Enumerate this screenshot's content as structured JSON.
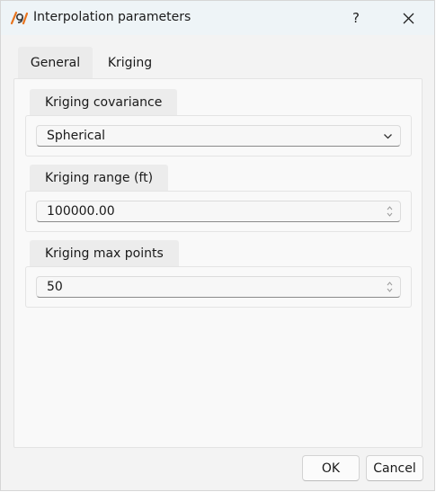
{
  "window": {
    "title": "Interpolation parameters",
    "help_label": "?",
    "close_label": "✕"
  },
  "tabs": [
    {
      "label": "General",
      "active": true
    },
    {
      "label": "Kriging",
      "active": false
    }
  ],
  "fields": {
    "covariance": {
      "label": "Kriging covariance",
      "value": "Spherical",
      "type": "select"
    },
    "range": {
      "label": "Kriging range (ft)",
      "value": "100000.00",
      "type": "spinbox"
    },
    "max_points": {
      "label": "Kriging max points",
      "value": "50",
      "type": "spinbox"
    }
  },
  "buttons": {
    "ok": "OK",
    "cancel": "Cancel"
  },
  "colors": {
    "titlebar": "#eef4f7",
    "app_icon_orange": "#e8731c",
    "app_icon_dark": "#3a3a3a"
  }
}
